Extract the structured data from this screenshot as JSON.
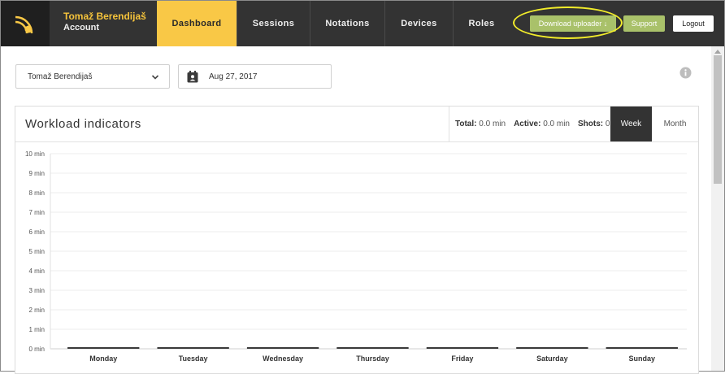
{
  "nav": {
    "account_name": "Tomaž Berendijaš",
    "account_sub": "Account",
    "tabs": [
      "Dashboard",
      "Sessions",
      "Notations",
      "Devices",
      "Roles"
    ],
    "active_tab": "Dashboard",
    "download_label": "Download uploader ↓",
    "support_label": "Support",
    "logout_label": "Logout"
  },
  "controls": {
    "user_select_value": "Tomaž Berendijaš",
    "date_value": "Aug 27, 2017"
  },
  "card": {
    "title": "Workload indicators",
    "total_label": "Total:",
    "total_value": "0.0 min",
    "active_label": "Active:",
    "active_value": "0.0 min",
    "shots_label": "Shots:",
    "shots_value": "0",
    "week_label": "Week",
    "month_label": "Month"
  },
  "colors": {
    "nav_bg": "#333333",
    "accent_yellow": "#f9c846",
    "button_green": "#a9c16a",
    "highlight_yellow": "#f2ec2a"
  },
  "chart_data": {
    "type": "bar",
    "categories": [
      "Monday",
      "Tuesday",
      "Wednesday",
      "Thursday",
      "Friday",
      "Saturday",
      "Sunday"
    ],
    "values": [
      0,
      0,
      0,
      0,
      0,
      0,
      0
    ],
    "ylim": [
      0,
      10
    ],
    "yticks": [
      "0 min",
      "1 min",
      "2 min",
      "3 min",
      "4 min",
      "5 min",
      "6 min",
      "7 min",
      "8 min",
      "9 min",
      "10 min"
    ],
    "grid": true
  }
}
